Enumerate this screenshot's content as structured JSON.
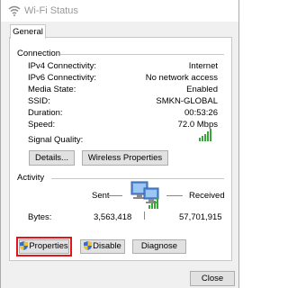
{
  "window": {
    "title": "Wi-Fi Status"
  },
  "tabs": [
    {
      "label": "General"
    }
  ],
  "connection": {
    "heading": "Connection",
    "rows": [
      {
        "label": "IPv4 Connectivity:",
        "value": "Internet"
      },
      {
        "label": "IPv6 Connectivity:",
        "value": "No network access"
      },
      {
        "label": "Media State:",
        "value": "Enabled"
      },
      {
        "label": "SSID:",
        "value": "SMKN-GLOBAL"
      },
      {
        "label": "Duration:",
        "value": "00:53:26"
      },
      {
        "label": "Speed:",
        "value": "72.0 Mbps"
      }
    ],
    "signal_label": "Signal Quality:",
    "signal_bars": 5,
    "details_button": "Details...",
    "wireless_button": "Wireless Properties"
  },
  "activity": {
    "heading": "Activity",
    "sent_label": "Sent",
    "received_label": "Received",
    "bytes_label": "Bytes:",
    "bytes_sent": "3,563,418",
    "bytes_received": "57,701,915"
  },
  "actions": {
    "properties": "Properties",
    "disable": "Disable",
    "diagnose": "Diagnose"
  },
  "footer": {
    "close": "Close"
  },
  "colors": {
    "highlight": "#e0161b",
    "signal": "#3aa63a",
    "shield_blue": "#2f6fd3",
    "shield_yellow": "#f2c230"
  }
}
